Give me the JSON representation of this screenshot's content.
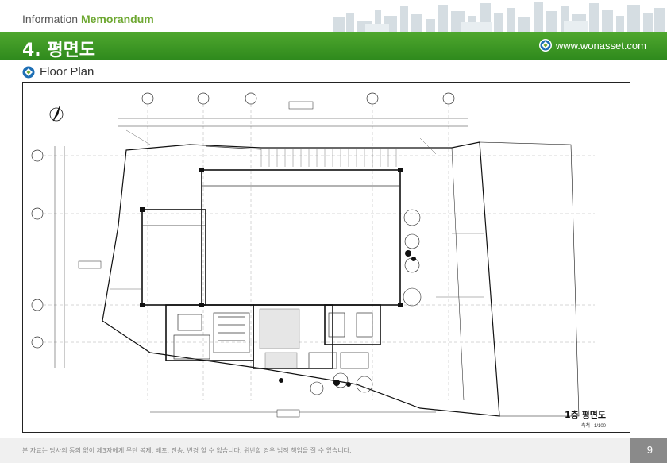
{
  "header": {
    "memo_prefix": "Information ",
    "memo_highlight": "Memorandum",
    "section_title": "4. 평면도",
    "brand_url": "www.wonasset.com"
  },
  "subheading": {
    "label": "Floor Plan"
  },
  "plan": {
    "title": "1층 평면도",
    "scale": "축척 : 1/100"
  },
  "footer": {
    "disclaimer": "본 자료는 당사의 동의 없이 제3자에게 무단 복제, 배포, 전송, 변경 할 수 없습니다. 위반할 경우 법적 책임을 질 수 있습니다.",
    "page_number": "9"
  },
  "colors": {
    "brand_green": "#3a9a25",
    "accent_green": "#6ea832",
    "brand_blue": "#1e6fb5"
  }
}
